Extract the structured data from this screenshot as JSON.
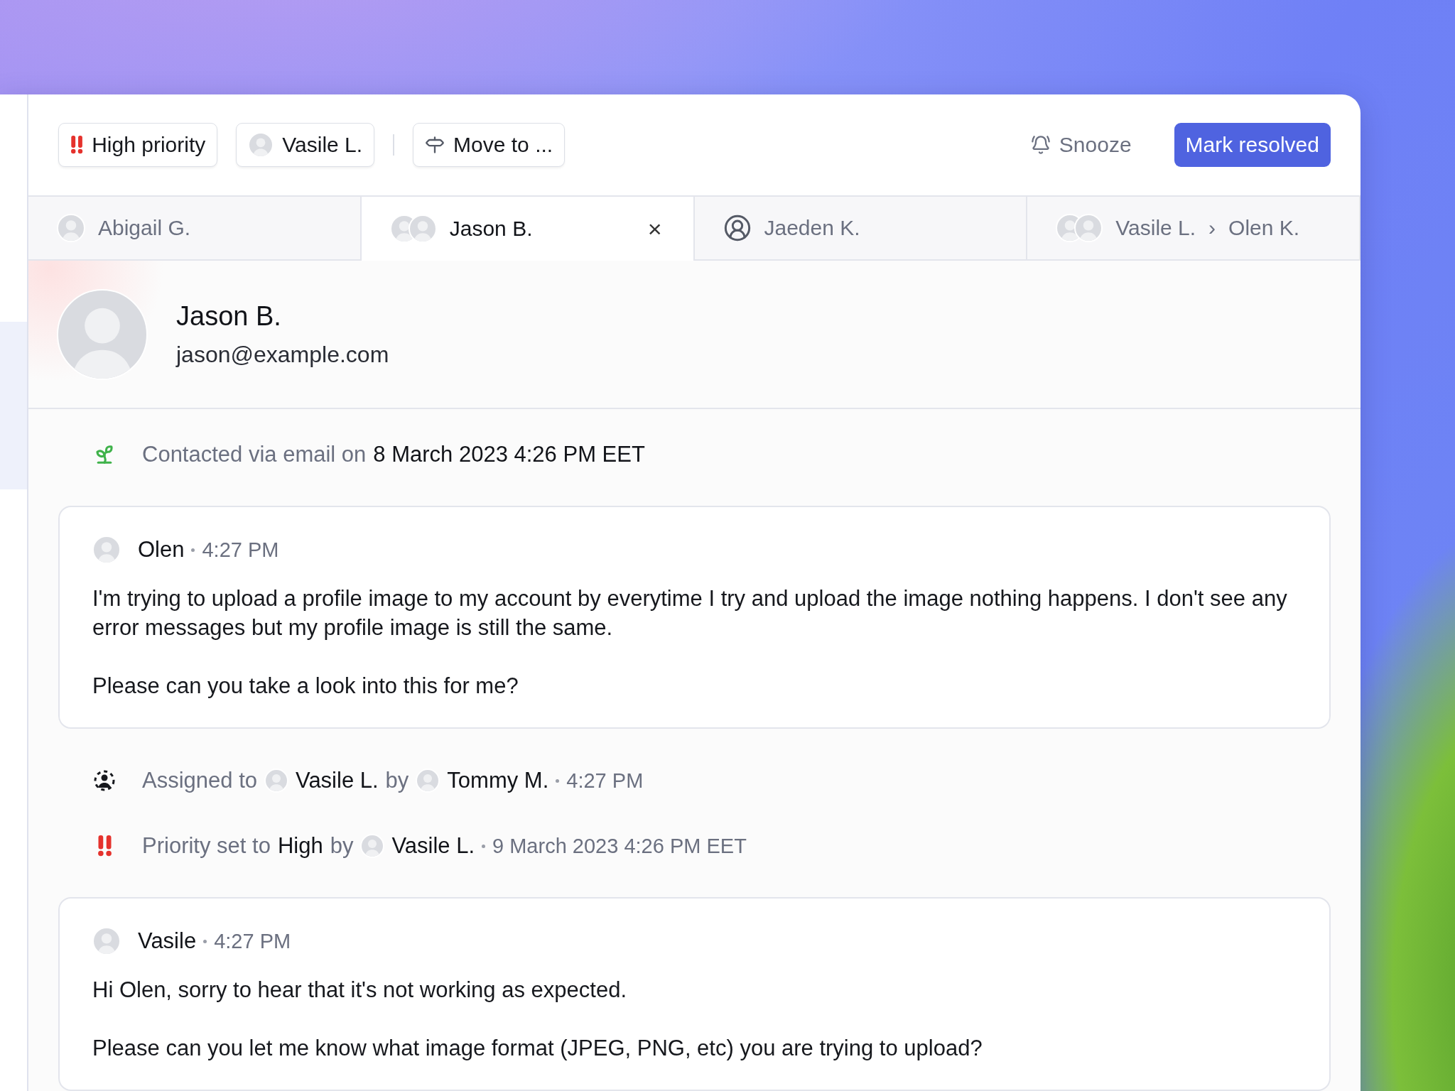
{
  "toolbar": {
    "priority_button": {
      "label": "High priority"
    },
    "assignee_button": {
      "label": "Vasile L."
    },
    "move_button": {
      "label": "Move to ..."
    },
    "snooze_button": {
      "label": "Snooze"
    },
    "resolve_button": {
      "label": "Mark resolved"
    }
  },
  "tabs": [
    {
      "kind": "photo",
      "label": "Abigail G.",
      "selected": false
    },
    {
      "kind": "photo-pair",
      "label": "Jason B.",
      "selected": true,
      "close": "×"
    },
    {
      "kind": "generic",
      "label": "Jaeden K.",
      "selected": false
    },
    {
      "kind": "photo-pair",
      "label": "Vasile L.",
      "separator": "›",
      "label_to": "Olen K.",
      "selected": false
    }
  ],
  "contact": {
    "name": "Jason B.",
    "email": "jason@example.com"
  },
  "timeline": [
    {
      "kind": "contacted",
      "text": "Contacted via email on",
      "date": "8 March 2023 4:26 PM EET"
    },
    {
      "kind": "message",
      "author": "Olen",
      "time": "4:27 PM",
      "paragraphs": [
        "I'm trying to upload a profile image to my account by everytime I try and upload the image nothing happens. I don't see any error messages but my profile image is still the same.",
        "Please can you take a look into this for me?"
      ]
    },
    {
      "kind": "assigned",
      "prefix": "Assigned to",
      "assignee": "Vasile L.",
      "by": "by",
      "actor": "Tommy M.",
      "time": "4:27 PM"
    },
    {
      "kind": "priority",
      "prefix": "Priority set to",
      "value": "High",
      "by": "by",
      "actor": "Vasile L.",
      "time": "9 March 2023 4:26 PM EET"
    },
    {
      "kind": "message",
      "author": "Vasile",
      "time": "4:27 PM",
      "paragraphs": [
        "Hi Olen, sorry to hear that it's not working as expected.",
        "Please can you let me know what image format (JPEG, PNG, etc) you are trying to upload?"
      ]
    }
  ]
}
